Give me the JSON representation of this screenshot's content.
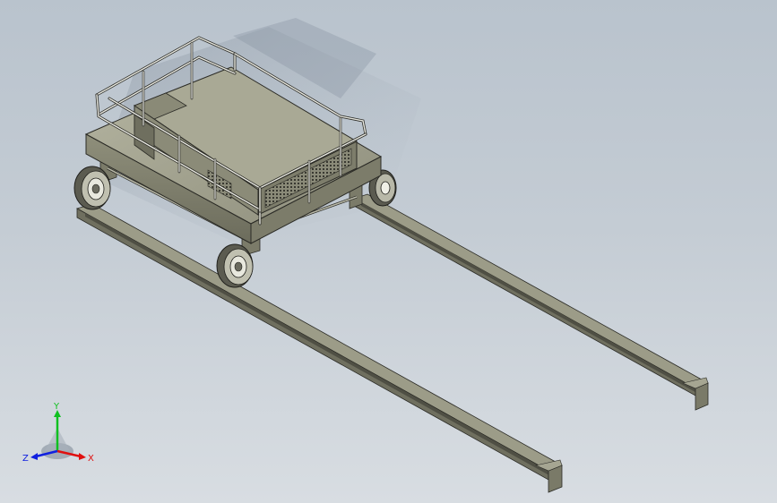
{
  "viewport": {
    "background_top": "#b9c3cd",
    "background_bottom": "#d8dde2"
  },
  "model": {
    "body_color": "#9a9a86",
    "body_dark": "#6e6e5e",
    "rail_color": "#8c8c78",
    "rail_dark": "#5a5a4c",
    "outline_color": "#2b2b26"
  },
  "triad": {
    "x_label": "X",
    "y_label": "Y",
    "z_label": "Z",
    "x_color": "#e01010",
    "y_color": "#10c020",
    "z_color": "#1020e0"
  }
}
